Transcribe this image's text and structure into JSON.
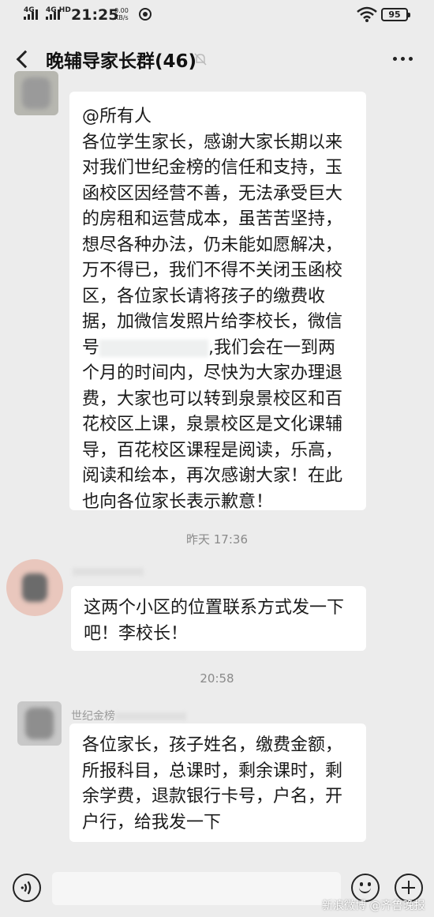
{
  "status_bar": {
    "net1": "4G",
    "net2": "4G HD",
    "time": "21:25",
    "speed_value": "0.00",
    "speed_unit": "KB/s",
    "battery": "95"
  },
  "header": {
    "title": "晚辅导家长群(46)"
  },
  "messages": [
    {
      "lines": [
        "@所有人",
        "各位学生家长，感谢大家长期以来",
        "对我们世纪金榜的信任和支持，玉",
        "函校区因经营不善，无法承受巨大",
        "的房租和运营成本，虽苦苦坚持，",
        "想尽各种办法，仍未能如愿解决，",
        "万不得已，我们不得不关闭玉函校",
        "区，各位家长请将孩子的缴费收",
        "据，加微信发照片给李校长，微信",
        "号",
        "个月的时间内，尽快为大家办理退",
        "费，大家也可以转到泉景校区和百",
        "花校区上课，泉景校区是文化课辅",
        "导，百花校区课程是阅读，乐高，",
        "阅读和绘本，再次感谢大家！在此",
        "也向各位家长表示歉意！"
      ],
      "line10_suffix": ",我们会在一到两"
    },
    {
      "lines": [
        "这两个小区的位置联系方式发一下",
        "吧！李校长！"
      ]
    },
    {
      "sender": "世纪金榜",
      "lines": [
        "各位家长，孩子姓名，缴费金额，",
        "所报科目，总课时，剩余课时，剩",
        "余学费，退款银行卡号，户名，开",
        "户行，给我发一下"
      ]
    }
  ],
  "timestamps": [
    "昨天 17:36",
    "20:58"
  ],
  "icons": {
    "back": "back-arrow-icon",
    "mute": "mute-bell-icon",
    "more": "more-dots-icon",
    "voice": "voice-icon",
    "emoji": "emoji-icon",
    "plus": "plus-icon"
  },
  "watermark": "新浪微博 @齐鲁晚报"
}
